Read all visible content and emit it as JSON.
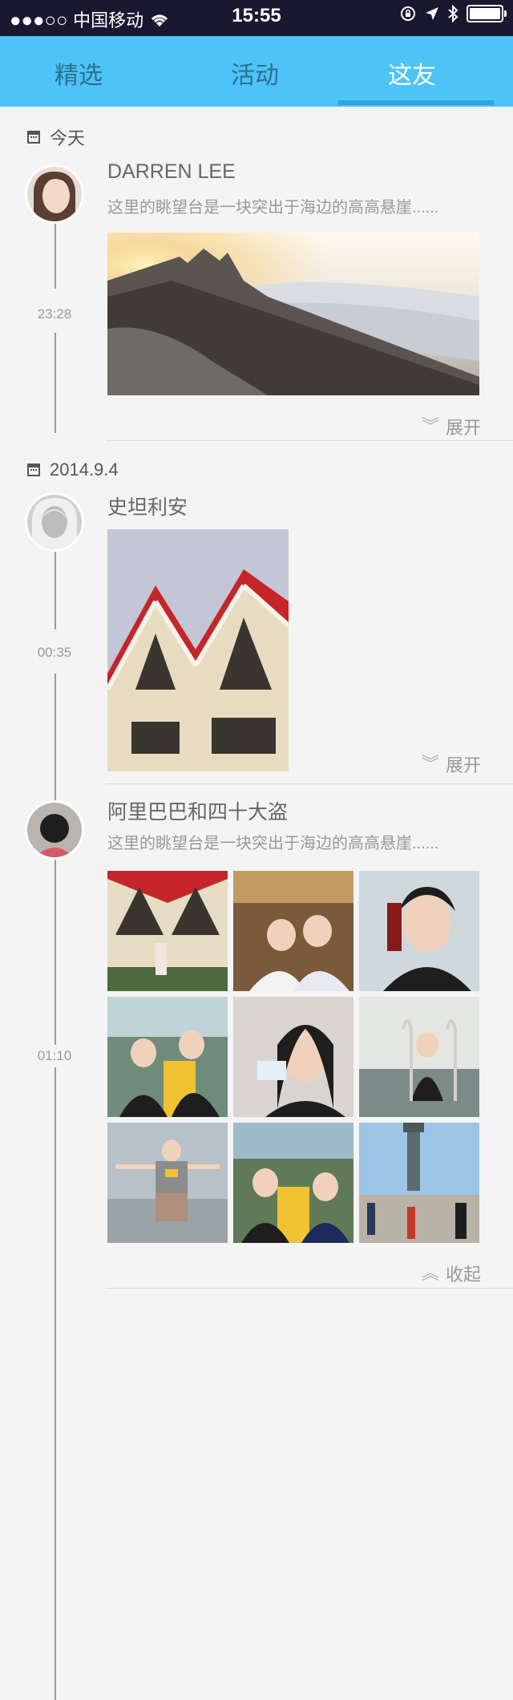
{
  "status_bar": {
    "signal": "●●●○○",
    "carrier": "中国移动",
    "time": "15:55"
  },
  "tabs": [
    {
      "label": "精选",
      "active": false
    },
    {
      "label": "活动",
      "active": false
    },
    {
      "label": "这友",
      "active": true
    }
  ],
  "feed": [
    {
      "date": "今天",
      "name": "DARREN LEE",
      "time": "23:28",
      "text": "这里的眺望台是一块突出于海边的高高悬崖......",
      "toggle": "展开"
    },
    {
      "date": "2014.9.4",
      "name": "史坦利安",
      "time": "00:35",
      "text": "",
      "toggle": "展开"
    },
    {
      "date": "",
      "name": "阿里巴巴和四十大盗",
      "time": "01:10",
      "text": "这里的眺望台是一块突出于海边的高高悬崖......",
      "toggle": "收起"
    }
  ],
  "icons": {
    "wifi": "wifi-icon",
    "lock": "rotation-lock-icon",
    "location": "location-arrow-icon",
    "bluetooth": "bluetooth-icon",
    "calendar": "calendar-icon",
    "expand": "double-chevron-down-icon",
    "collapse": "double-chevron-up-icon"
  },
  "colors": {
    "accent": "#4dc3f7",
    "status_bar": "#1a1830"
  }
}
